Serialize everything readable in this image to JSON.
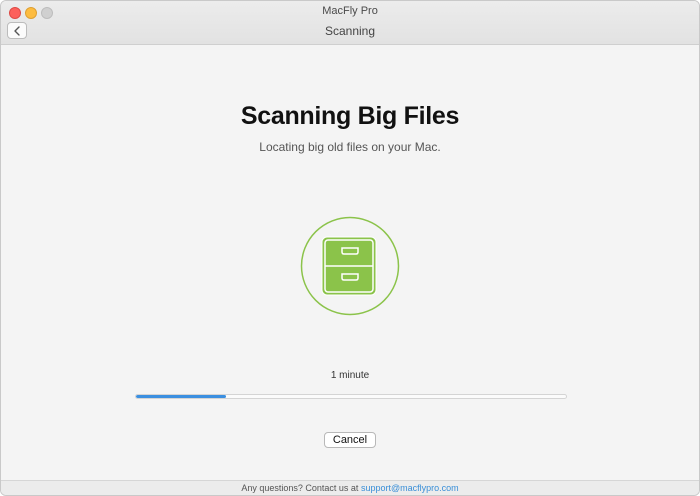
{
  "window": {
    "app_title": "MacFly Pro",
    "page_subtitle": "Scanning"
  },
  "main": {
    "heading": "Scanning Big Files",
    "subheading": "Locating big old files on your Mac.",
    "icon": "file-cabinet-icon",
    "time_remaining": "1 minute",
    "progress_percent": 21,
    "cancel_label": "Cancel"
  },
  "footer": {
    "prefix": "Any questions? Contact us at",
    "email": "support@macflypro.com"
  },
  "colors": {
    "accent_green": "#8bc34a",
    "progress_blue": "#3b8fe0",
    "link_blue": "#3a8fd8"
  }
}
